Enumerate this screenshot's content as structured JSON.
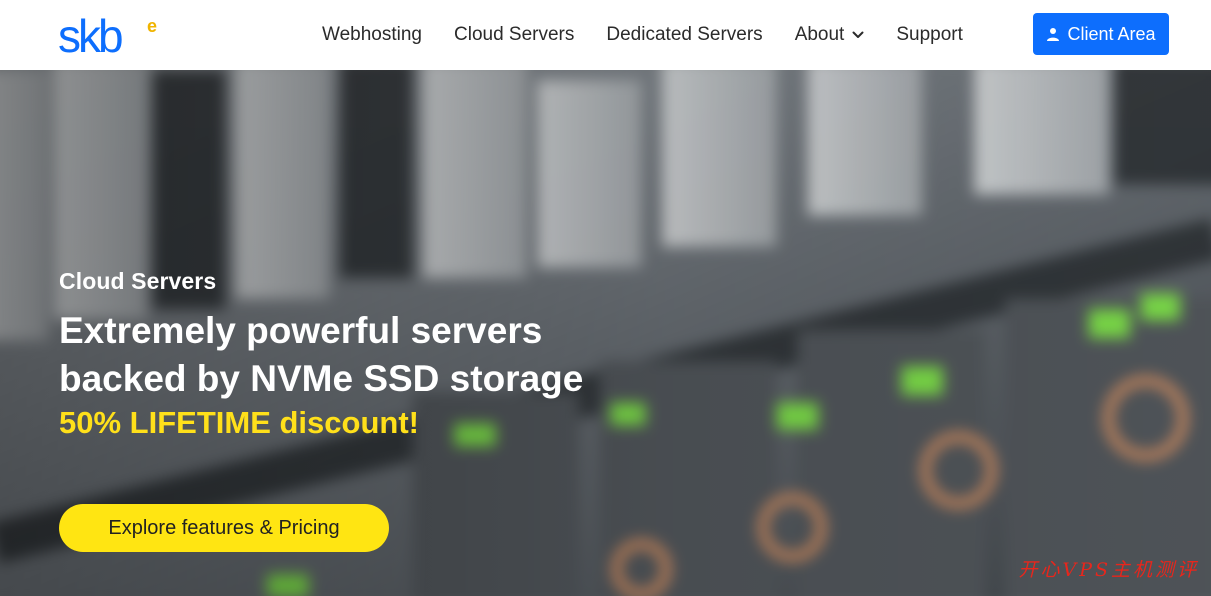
{
  "brand": {
    "logo_text": "skb",
    "logo_superscript": "e",
    "primary": "#0d6efd",
    "logo_accent": "#f0b400"
  },
  "nav": {
    "items": [
      {
        "label": "Webhosting"
      },
      {
        "label": "Cloud Servers"
      },
      {
        "label": "Dedicated Servers"
      },
      {
        "label": "About"
      },
      {
        "label": "Support"
      }
    ],
    "client_area_label": "Client Area"
  },
  "hero": {
    "eyebrow": "Cloud Servers",
    "headline_line1": "Extremely powerful servers",
    "headline_line2": "backed by NVMe SSD storage",
    "promo": "50% LIFETIME discount!",
    "cta_label": "Explore features & Pricing",
    "promo_color": "#ffe01a",
    "cta_color": "#ffe512"
  },
  "watermark": "开心VPS主机测评"
}
